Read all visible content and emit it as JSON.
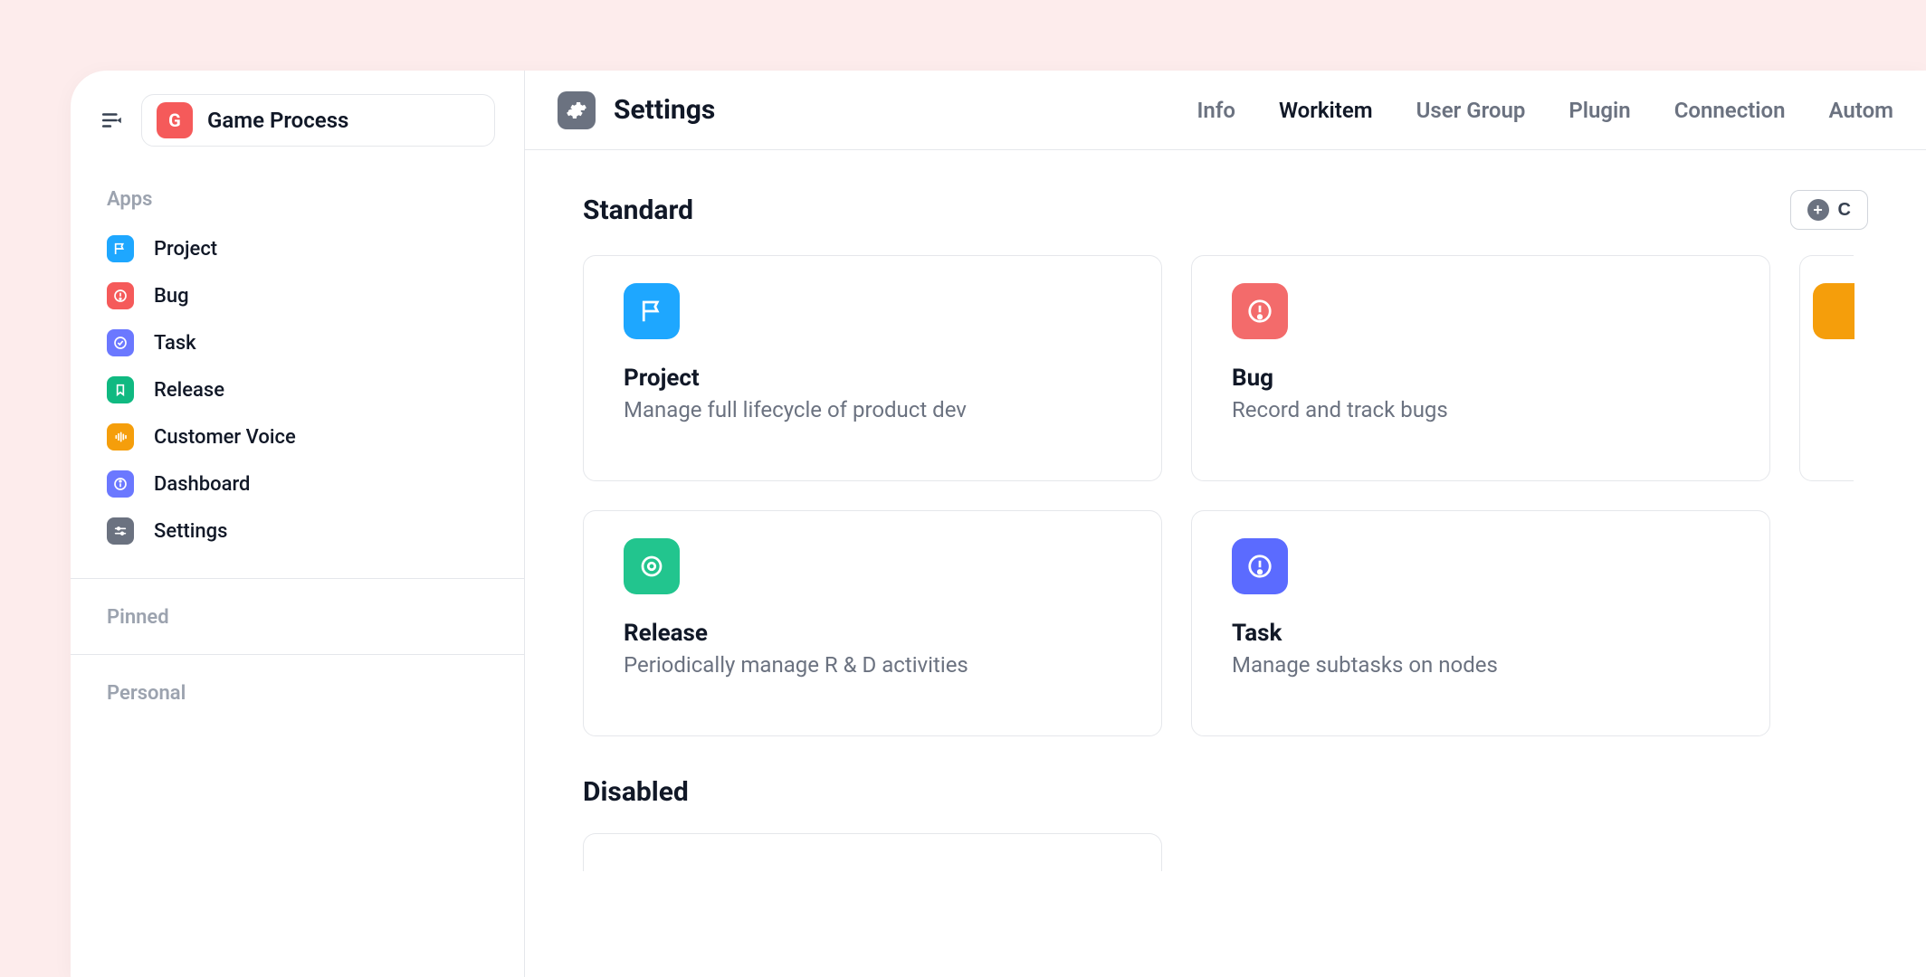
{
  "workspace": {
    "initial": "G",
    "label": "Game Process",
    "icon_bg": "#f55a5a"
  },
  "sidebar": {
    "sections": {
      "apps": "Apps",
      "pinned": "Pinned",
      "personal": "Personal"
    },
    "items": [
      {
        "label": "Project",
        "icon": "flag",
        "bg": "#1ea7ff"
      },
      {
        "label": "Bug",
        "icon": "alert",
        "bg": "#f55a5a"
      },
      {
        "label": "Task",
        "icon": "check",
        "bg": "#6b78ff"
      },
      {
        "label": "Release",
        "icon": "bookmark",
        "bg": "#10b981"
      },
      {
        "label": "Customer Voice",
        "icon": "voice",
        "bg": "#f59e0b"
      },
      {
        "label": "Dashboard",
        "icon": "info",
        "bg": "#6b78ff"
      },
      {
        "label": "Settings",
        "icon": "sliders",
        "bg": "#6b7280"
      }
    ]
  },
  "page": {
    "title": "Settings"
  },
  "tabs": [
    {
      "label": "Info",
      "active": false
    },
    {
      "label": "Workitem",
      "active": true
    },
    {
      "label": "User Group",
      "active": false
    },
    {
      "label": "Plugin",
      "active": false
    },
    {
      "label": "Connection",
      "active": false
    },
    {
      "label": "Autom",
      "active": false
    }
  ],
  "sections": {
    "standard": "Standard",
    "disabled": "Disabled"
  },
  "create_btn_label": "C",
  "cards": [
    {
      "title": "Project",
      "desc": "Manage full lifecycle of product dev",
      "bg": "#1ea7ff",
      "icon": "flag"
    },
    {
      "title": "Bug",
      "desc": "Record and track bugs",
      "bg": "#f36b6b",
      "icon": "alert"
    },
    {
      "title": "Release",
      "desc": "Periodically manage R & D activities",
      "bg": "#22c58e",
      "icon": "refresh"
    },
    {
      "title": "Task",
      "desc": "Manage subtasks on nodes",
      "bg": "#5b6bff",
      "icon": "alert"
    }
  ],
  "peek_card": {
    "bg": "#f59e0b"
  }
}
